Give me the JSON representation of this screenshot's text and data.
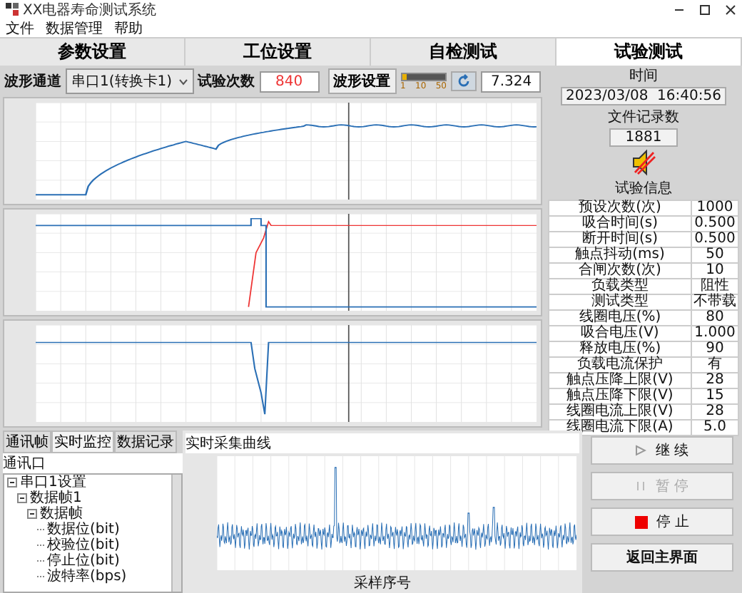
{
  "window": {
    "title": "XX电器寿命测试系统"
  },
  "menu": [
    "文件",
    "数据管理",
    "帮助"
  ],
  "tabs": [
    {
      "label": "参数设置",
      "selected": false
    },
    {
      "label": "工位设置",
      "selected": false
    },
    {
      "label": "自检测试",
      "selected": false
    },
    {
      "label": "试验测试",
      "selected": true
    }
  ],
  "toolbar": {
    "channel_label": "波形通道",
    "channel_value": "串口1(转换卡1)",
    "count_label": "试验次数",
    "count_value": "840",
    "wave_button": "波形设置",
    "slider": {
      "level": 0.1,
      "ticks": [
        "1",
        "10",
        "50"
      ]
    },
    "value": "7.324"
  },
  "side": {
    "time_label": "时间",
    "time_value": "2023/03/08  16:40:56",
    "records_label": "文件记录数",
    "records_value": "1881",
    "muted": true,
    "info_title": "试验信息",
    "info": [
      {
        "label": "预设次数(次)",
        "value": "1000"
      },
      {
        "label": "吸合时间(s)",
        "value": "0.500"
      },
      {
        "label": "断开时间(s)",
        "value": "0.500"
      },
      {
        "label": "触点抖动(ms)",
        "value": "50"
      },
      {
        "label": "合闸次数(次)",
        "value": "10"
      },
      {
        "label": "负载类型",
        "value": "阻性"
      },
      {
        "label": "测试类型",
        "value": "不带载"
      },
      {
        "label": "线圈电压(%)",
        "value": "80"
      },
      {
        "label": "吸合电压(V)",
        "value": "1.000"
      },
      {
        "label": "释放电压(%)",
        "value": "90"
      },
      {
        "label": "负载电流保护",
        "value": "有"
      },
      {
        "label": "触点压降上限(V)",
        "value": "28"
      },
      {
        "label": "触点压降下限(V)",
        "value": "15"
      },
      {
        "label": "线圈电流上限(V)",
        "value": "28"
      },
      {
        "label": "线圈电流下限(A)",
        "value": "5.0"
      }
    ]
  },
  "bottom": {
    "tabs": [
      {
        "label": "通讯帧",
        "selected": false
      },
      {
        "label": "实时监控",
        "selected": true
      },
      {
        "label": "数据记录",
        "selected": false
      }
    ],
    "tree_header": "通讯口",
    "tree": [
      {
        "label": "串口1设置",
        "expanded": true,
        "children": [
          {
            "label": "数据帧1",
            "expanded": true,
            "children": [
              {
                "label": "数据帧",
                "expanded": true,
                "children": [
                  {
                    "label": "数据位(bit)"
                  },
                  {
                    "label": "校验位(bit)"
                  },
                  {
                    "label": "停止位(bit)"
                  },
                  {
                    "label": "波特率(bps)"
                  }
                ]
              }
            ]
          }
        ]
      }
    ],
    "chart_title": "实时采集曲线",
    "xlabel": "采样序号"
  },
  "buttons": [
    {
      "label": "继 续",
      "kind": "play",
      "disabled": false
    },
    {
      "label": "暂 停",
      "kind": "pause",
      "disabled": true
    },
    {
      "label": "停 止",
      "kind": "stop",
      "disabled": false
    },
    {
      "label": "返回主界面",
      "kind": "plain",
      "disabled": false
    }
  ]
}
